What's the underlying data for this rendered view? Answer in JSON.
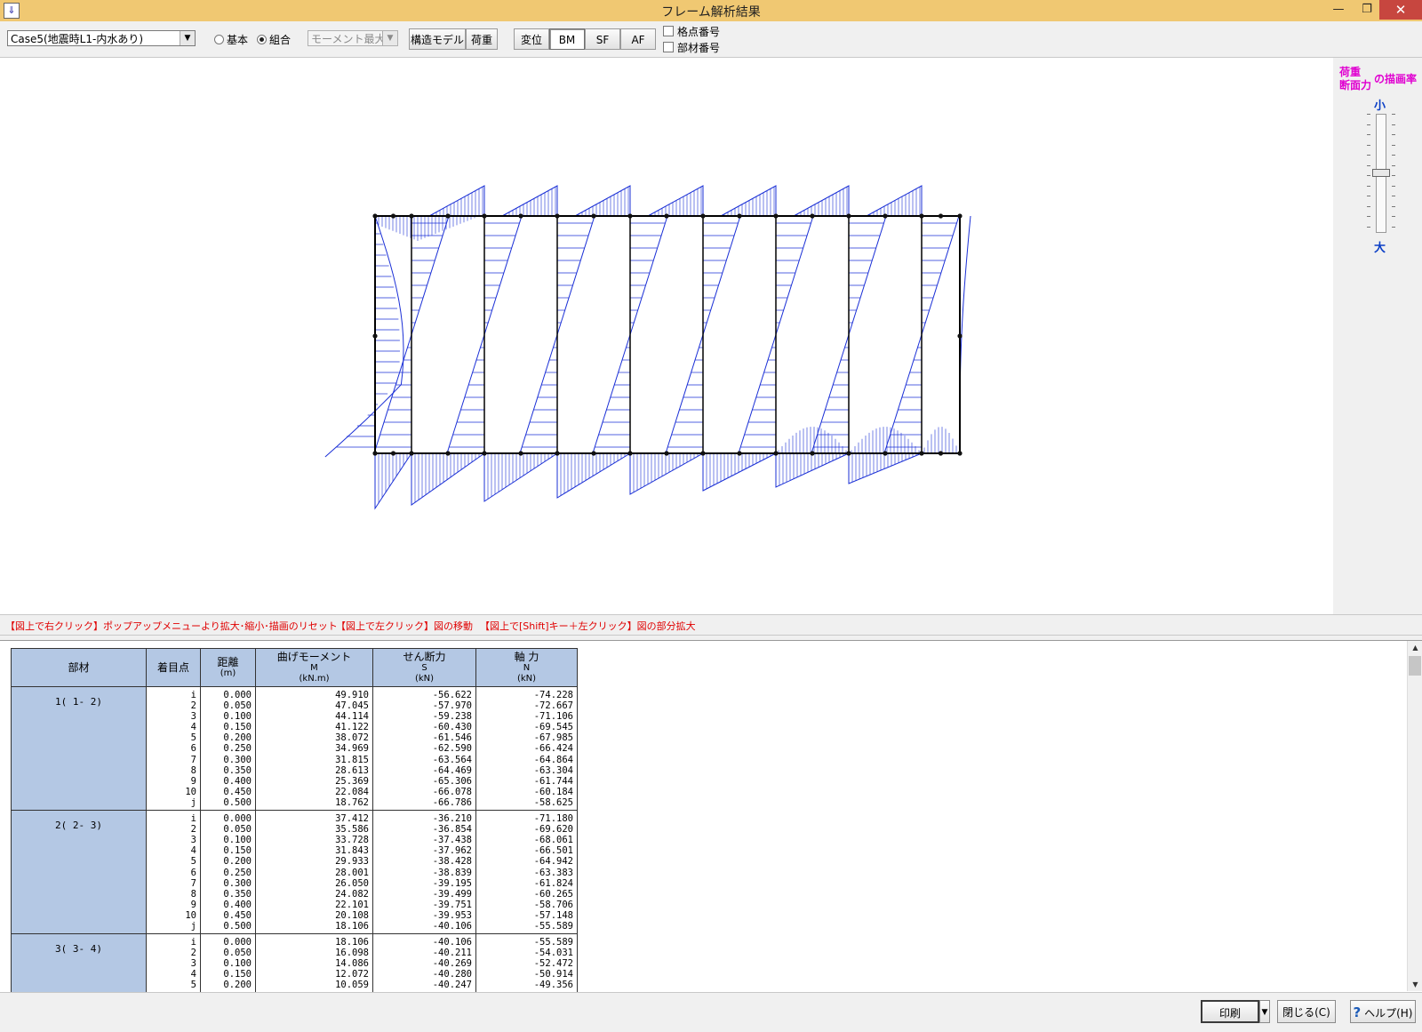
{
  "window": {
    "title": "フレーム解析結果",
    "app_icon_glyph": "⇓",
    "minimize": "—",
    "maximize": "❐",
    "close": "✕"
  },
  "toolbar": {
    "case_select": {
      "value": "Case5(地震時L1-内水あり)",
      "arrow": "▼"
    },
    "radio_basic": "基本",
    "radio_combined": "組合",
    "radio_selected": "combined",
    "moment_select": {
      "value": "モーメント最大",
      "arrow": "▼",
      "disabled": true
    },
    "structure_model_button": "構造モデル",
    "load_button": "荷重",
    "displacement_button": "変位",
    "bm_button": "BM",
    "sf_button": "SF",
    "af_button": "AF",
    "active_view": "BM",
    "node_number_checkbox": "格点番号",
    "member_number_checkbox": "部材番号"
  },
  "scale_panel": {
    "label_load": "荷重",
    "label_section_force": "断面力",
    "label_ratio": "の描画率",
    "small": "小",
    "large": "大"
  },
  "hints": [
    "【図上で右クリック】ポップアップメニューより拡大･縮小･描画のリセット",
    "【図上で左クリック】図の移動",
    "【図上で[Shift]キー＋左クリック】図の部分拡大"
  ],
  "table": {
    "headers": {
      "member": "部材",
      "point": "着目点",
      "distance": "距離",
      "distance_unit": "(m)",
      "moment": "曲げモーメント",
      "moment_symbol": "M",
      "moment_unit": "(kN.m)",
      "shear": "せん断力",
      "shear_symbol": "S",
      "shear_unit": "(kN)",
      "axial": "軸 力",
      "axial_symbol": "N",
      "axial_unit": "(kN)"
    },
    "members": [
      {
        "name": "1( 1- 2)",
        "points": [
          "i",
          "2",
          "3",
          "4",
          "5",
          "6",
          "7",
          "8",
          "9",
          "10",
          "j"
        ],
        "distance": [
          "0.000",
          "0.050",
          "0.100",
          "0.150",
          "0.200",
          "0.250",
          "0.300",
          "0.350",
          "0.400",
          "0.450",
          "0.500"
        ],
        "moment": [
          "49.910",
          "47.045",
          "44.114",
          "41.122",
          "38.072",
          "34.969",
          "31.815",
          "28.613",
          "25.369",
          "22.084",
          "18.762"
        ],
        "shear": [
          "-56.622",
          "-57.970",
          "-59.238",
          "-60.430",
          "-61.546",
          "-62.590",
          "-63.564",
          "-64.469",
          "-65.306",
          "-66.078",
          "-66.786"
        ],
        "axial": [
          "-74.228",
          "-72.667",
          "-71.106",
          "-69.545",
          "-67.985",
          "-66.424",
          "-64.864",
          "-63.304",
          "-61.744",
          "-60.184",
          "-58.625"
        ]
      },
      {
        "name": "2( 2- 3)",
        "points": [
          "i",
          "2",
          "3",
          "4",
          "5",
          "6",
          "7",
          "8",
          "9",
          "10",
          "j"
        ],
        "distance": [
          "0.000",
          "0.050",
          "0.100",
          "0.150",
          "0.200",
          "0.250",
          "0.300",
          "0.350",
          "0.400",
          "0.450",
          "0.500"
        ],
        "moment": [
          "37.412",
          "35.586",
          "33.728",
          "31.843",
          "29.933",
          "28.001",
          "26.050",
          "24.082",
          "22.101",
          "20.108",
          "18.106"
        ],
        "shear": [
          "-36.210",
          "-36.854",
          "-37.438",
          "-37.962",
          "-38.428",
          "-38.839",
          "-39.195",
          "-39.499",
          "-39.751",
          "-39.953",
          "-40.106"
        ],
        "axial": [
          "-71.180",
          "-69.620",
          "-68.061",
          "-66.501",
          "-64.942",
          "-63.383",
          "-61.824",
          "-60.265",
          "-58.706",
          "-57.148",
          "-55.589"
        ]
      },
      {
        "name": "3( 3- 4)",
        "points": [
          "i",
          "2",
          "3",
          "4",
          "5"
        ],
        "distance": [
          "0.000",
          "0.050",
          "0.100",
          "0.150",
          "0.200"
        ],
        "moment": [
          "18.106",
          "16.098",
          "14.086",
          "12.072",
          "10.059"
        ],
        "shear": [
          "-40.106",
          "-40.211",
          "-40.269",
          "-40.280",
          "-40.247"
        ],
        "axial": [
          "-55.589",
          "-54.031",
          "-52.472",
          "-50.914",
          "-49.356"
        ]
      }
    ]
  },
  "footer": {
    "print_button": "印刷",
    "print_dropdown": "▼",
    "close_button": "閉じる(C)",
    "help_button": "ヘルプ(H)",
    "help_icon": "?"
  },
  "colors": {
    "diagram": "#1a2fd6",
    "frame": "#000000",
    "header_bg": "#b4c8e4",
    "hint_text": "#e00000",
    "scale_label": "#e000d0"
  }
}
